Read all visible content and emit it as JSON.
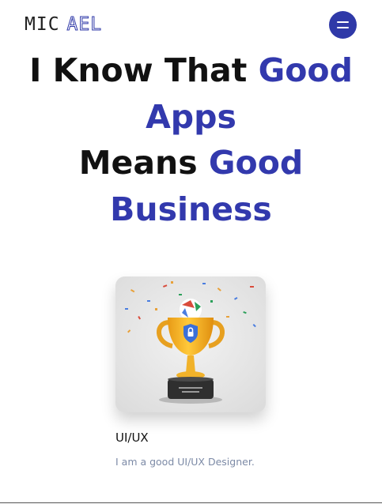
{
  "logo": {
    "part1": "MIC",
    "part2": "AEL"
  },
  "hero": {
    "line1_dark": "I Know That ",
    "line1_accent": "Good",
    "line2_accent": "Apps",
    "line3_dark": "Means ",
    "line3_accent": "Good",
    "line4_accent": "Business"
  },
  "card": {
    "title": "UI/UX",
    "description": "I am a good UI/UX Designer.",
    "image_icon": "trophy-icon"
  },
  "colors": {
    "accent": "#3239ad",
    "menu_bg": "#2f39a8",
    "description": "#7c8aa6"
  }
}
